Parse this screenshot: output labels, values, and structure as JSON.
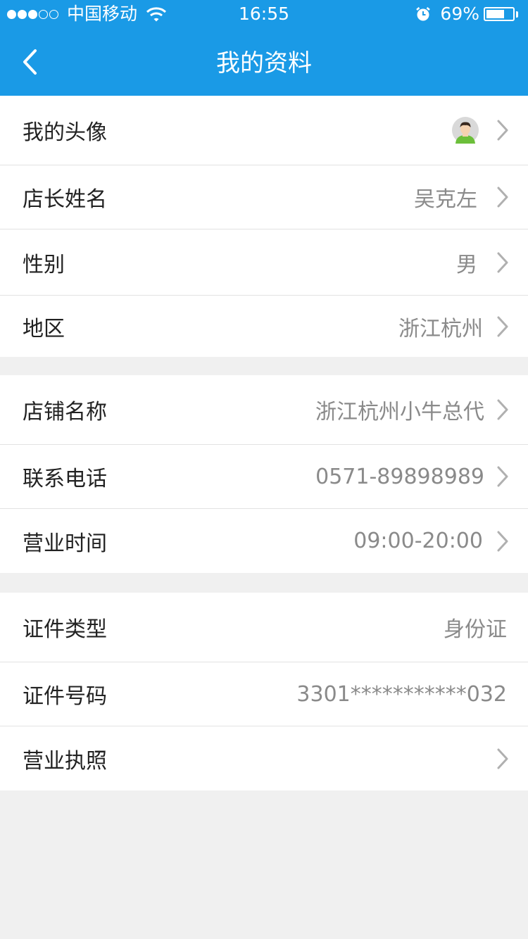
{
  "status_bar": {
    "signal_filled": 3,
    "signal_total": 5,
    "carrier": "中国移动",
    "wifi_icon": "wifi-icon",
    "time": "16:55",
    "alarm_icon": "alarm-icon",
    "battery_percent": "69%",
    "battery_level": 0.69
  },
  "nav": {
    "title": "我的资料",
    "back_icon": "chevron-left-icon"
  },
  "section1": [
    {
      "label": "我的头像",
      "value": "",
      "avatar": "avatar-icon",
      "chevron": true
    },
    {
      "label": "店长姓名",
      "value": "吴克左",
      "chevron": true
    },
    {
      "label": "性别",
      "value": "男",
      "chevron": true
    },
    {
      "label": "地区",
      "value": "浙江杭州",
      "chevron": true
    }
  ],
  "section2": [
    {
      "label": "店铺名称",
      "value": "浙江杭州小牛总代",
      "chevron": true
    },
    {
      "label": "联系电话",
      "value": "0571-89898989",
      "chevron": true
    },
    {
      "label": "营业时间",
      "value": "09:00-20:00",
      "chevron": true
    }
  ],
  "section3": [
    {
      "label": "证件类型",
      "value": "身份证",
      "chevron": false
    },
    {
      "label": "证件号码",
      "value": "3301***********032",
      "chevron": false
    },
    {
      "label": "营业执照",
      "value": "",
      "chevron": true
    }
  ],
  "colors": {
    "header_bg": "#1a9ae6",
    "page_bg": "#f0f0f0",
    "value_text": "#8a8a8a",
    "label_text": "#222222"
  }
}
